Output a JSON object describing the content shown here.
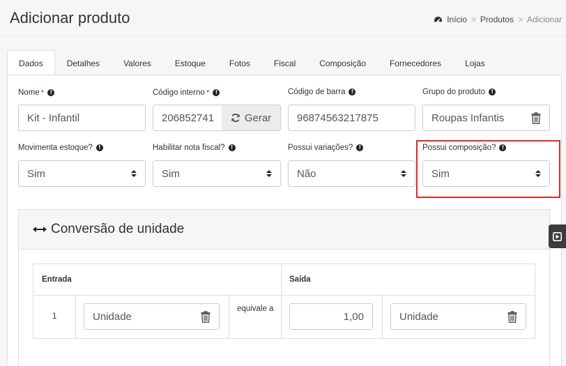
{
  "header": {
    "title": "Adicionar produto",
    "breadcrumb": [
      "Início",
      "Produtos",
      "Adicionar"
    ],
    "separator": ">"
  },
  "tabs": [
    {
      "label": "Dados",
      "active": true
    },
    {
      "label": "Detalhes"
    },
    {
      "label": "Valores"
    },
    {
      "label": "Estoque"
    },
    {
      "label": "Fotos"
    },
    {
      "label": "Fiscal"
    },
    {
      "label": "Composição"
    },
    {
      "label": "Fornecedores"
    },
    {
      "label": "Lojas"
    }
  ],
  "form": {
    "nome": {
      "label": "Nome",
      "required": "*",
      "value": "Kit - Infantil"
    },
    "codigo_interno": {
      "label": "Código interno",
      "required": "*",
      "value": "206852741",
      "button": "Gerar"
    },
    "codigo_barra": {
      "label": "Código de barra",
      "value": "96874563217875"
    },
    "grupo": {
      "label": "Grupo do produto",
      "value": "Roupas Infantis"
    },
    "movimenta_estoque": {
      "label": "Movimenta estoque?",
      "value": "Sim"
    },
    "habilitar_nota": {
      "label": "Habilitar nota fiscal?",
      "value": "Sim"
    },
    "possui_variacoes": {
      "label": "Possui variações?",
      "value": "Não"
    },
    "possui_composicao": {
      "label": "Possui composição?",
      "value": "Sim"
    }
  },
  "info_glyph": "!",
  "conversion": {
    "title": "Conversão de unidade",
    "col_entrada": "Entrada",
    "col_saida": "Saída",
    "row": {
      "qty_in": "1",
      "unit_in": "Unidade",
      "equivale": "equivale a",
      "qty_out": "1,00",
      "unit_out": "Unidade"
    }
  },
  "colors": {
    "highlight": "#e02828",
    "required": "#e03030"
  }
}
